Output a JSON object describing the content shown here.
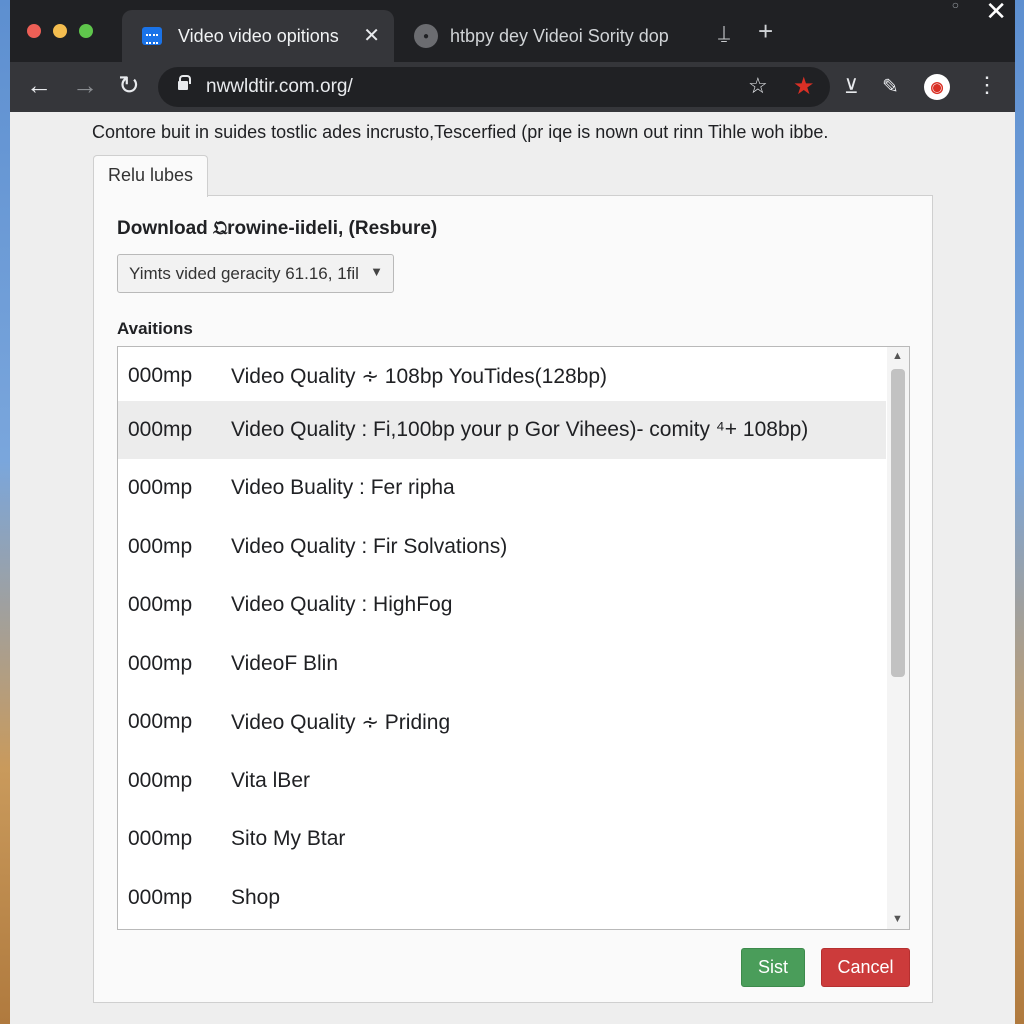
{
  "browser": {
    "tabs": [
      {
        "title": "Video video opitions",
        "favicon": "video-site-icon",
        "close": "✕"
      },
      {
        "title": "htbpy dey Videoi Sority dop",
        "favicon": "globe-icon"
      }
    ],
    "new_tab": "+",
    "window_close": "✕",
    "url": "nwwldtir.com.org/"
  },
  "page": {
    "intro_text": "Contore buit in suides tostlic ades incrusto,Tescerfied (pr iqe is nown out rinn Tihle woh ibbe.",
    "panel_tab_label": "Relu lubes",
    "download_label": "Download 𝔔rowine-iideli, (Resbure)",
    "select_value": "Yimts vided geracity 61.16, 1fil",
    "available_label": "Avaitions",
    "items": [
      {
        "size": "000mp",
        "name": "Video Quality ∻ 108bp YouTides(128bp)"
      },
      {
        "size": "000mp",
        "name": "Video Quality : Fi,100bp your p Gor Vihees)- comity ⁴+ 108bp)"
      },
      {
        "size": "000mp",
        "name": "Video Buality : Fer ripha"
      },
      {
        "size": "000mp",
        "name": "Video Quality : Fir Solvations)"
      },
      {
        "size": "000mp",
        "name": "Video Quality : HighFog"
      },
      {
        "size": "000mp",
        "name": "VideoF Blin"
      },
      {
        "size": "000mp",
        "name": "Video Quality ∻ Priding"
      },
      {
        "size": "000mp",
        "name": "Vita lBer"
      },
      {
        "size": "000mp",
        "name": "Sito My Btar"
      },
      {
        "size": "000mp",
        "name": "Shop"
      }
    ],
    "selected_index": 1,
    "start_button": "Sist",
    "cancel_button": "Cancel"
  },
  "colors": {
    "start": "#4a9d5a",
    "cancel": "#cc3b3b",
    "chrome_dark": "#202124",
    "star_red": "#d93025"
  }
}
